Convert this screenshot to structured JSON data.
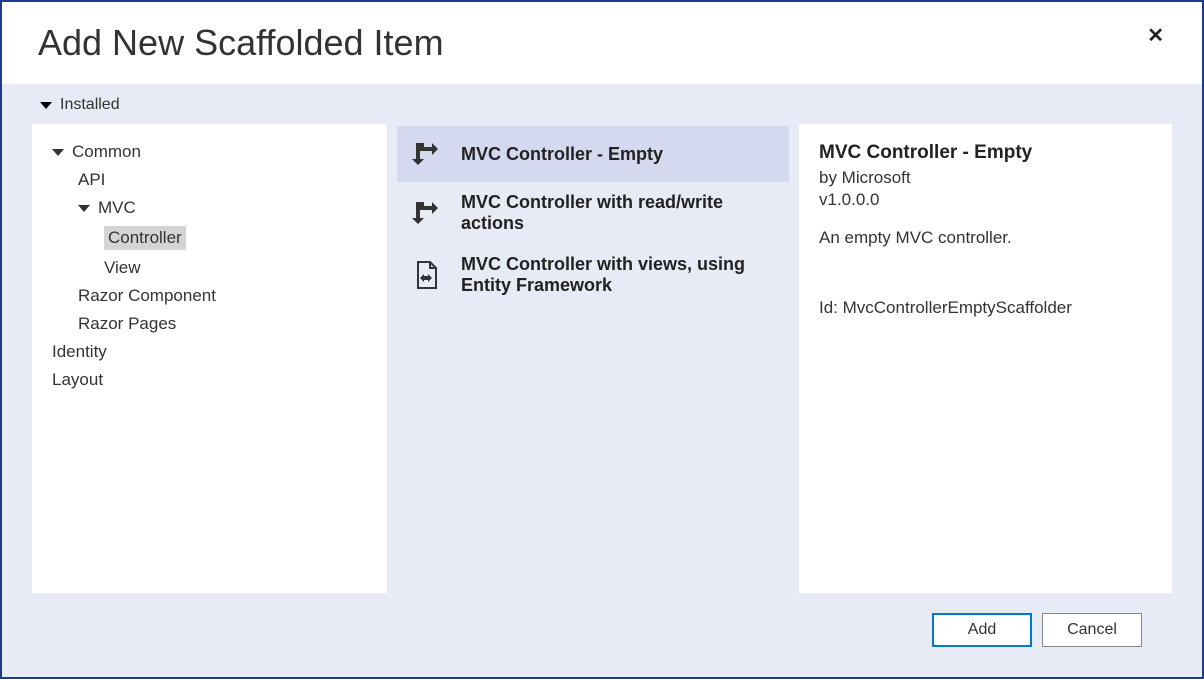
{
  "dialog": {
    "title": "Add New Scaffolded Item",
    "section_label": "Installed"
  },
  "tree": {
    "common": "Common",
    "api": "API",
    "mvc": "MVC",
    "controller": "Controller",
    "view": "View",
    "razor_component": "Razor Component",
    "razor_pages": "Razor Pages",
    "identity": "Identity",
    "layout": "Layout"
  },
  "templates": {
    "t1": "MVC Controller - Empty",
    "t2": "MVC Controller with read/write actions",
    "t3": "MVC Controller with views, using Entity Framework"
  },
  "details": {
    "title": "MVC Controller - Empty",
    "author": "by Microsoft",
    "version": "v1.0.0.0",
    "description": "An empty MVC controller.",
    "id": "Id: MvcControllerEmptyScaffolder"
  },
  "buttons": {
    "add": "Add",
    "cancel": "Cancel"
  }
}
